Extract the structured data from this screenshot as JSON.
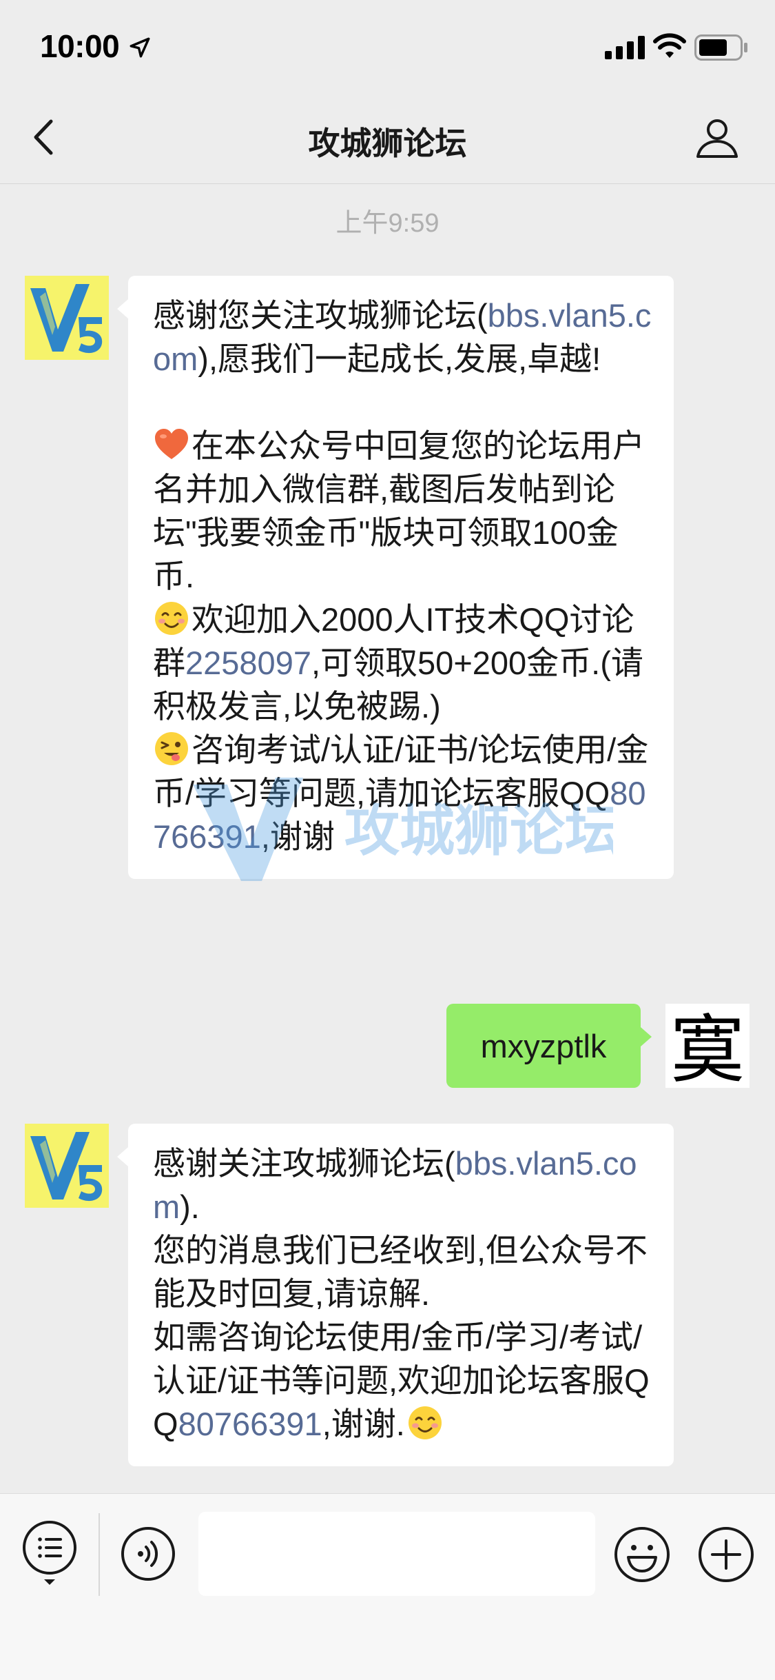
{
  "status_bar": {
    "time": "10:00"
  },
  "nav": {
    "title": "攻城狮论坛"
  },
  "chat": {
    "timestamp": "上午9:59",
    "msg1": {
      "p1a": "感谢您关注攻城狮论坛(",
      "link1": "bbs.vlan5.com",
      "p1b": "),愿我们一起成长,发展,卓越!",
      "p2": "在本公众号中回复您的论坛用户名并加入微信群,截图后发帖到论坛\"我要领金币\"版块可领取100金币.",
      "p3a": "欢迎加入2000人IT技术QQ讨论群",
      "qq_group": "2258097",
      "p3b": ",可领取50+200金币.(请积极发言,以免被踢.)",
      "p4a": "咨询考试/认证/证书/论坛使用/金币/学习等问题,请加论坛客服QQ",
      "qq_service": "80766391",
      "p4b": ",谢谢"
    },
    "msg_out": {
      "text": "mxyzptlk"
    },
    "msg2": {
      "p1a": "感谢关注攻城狮论坛(",
      "link1": "bbs.vlan5.com",
      "p1b": ").",
      "p2": "您的消息我们已经收到,但公众号不能及时回复,请谅解.",
      "p3a": "如需咨询论坛使用/金币/学习/考试/认证/证书等问题,欢迎加论坛客服QQ",
      "qq_service": "80766391",
      "p3b": ",谢谢."
    },
    "watermark_text": "攻城狮论坛",
    "avatar_user_glyph": "寞"
  },
  "colors": {
    "link": "#576b95",
    "bubble_out": "#95ec69",
    "avatar_bg": "#f6f36b"
  },
  "icons": [
    "location-arrow-icon",
    "signal-icon",
    "wifi-icon",
    "battery-icon",
    "back-chevron-icon",
    "profile-icon",
    "heart-emoji",
    "smile-emoji",
    "wink-emoji",
    "menu-list-icon",
    "voice-icon",
    "emoji-icon",
    "plus-icon"
  ]
}
